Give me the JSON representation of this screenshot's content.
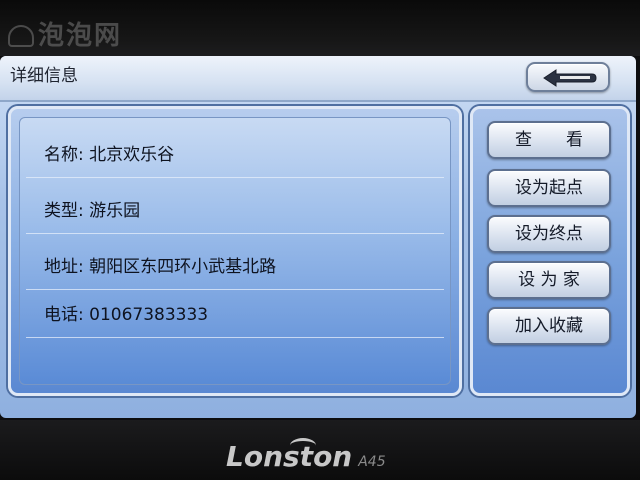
{
  "watermark": "泡泡网",
  "window": {
    "title": "详细信息"
  },
  "details": [
    {
      "text": "名称: 北京欢乐谷"
    },
    {
      "text": "类型: 游乐园"
    },
    {
      "text": "地址: 朝阳区东四环小武基北路"
    },
    {
      "text": "电话: 01067383333"
    }
  ],
  "actions": {
    "view": "查　　看",
    "set_start": "设为起点",
    "set_end": "设为终点",
    "set_home": "设 为 家",
    "add_favorite": "加入收藏"
  },
  "device": {
    "brand": "Lonston",
    "model": "A45"
  },
  "icons": {
    "back": "back-arrow-icon"
  },
  "colors": {
    "screen_blue": "#8fb0df",
    "panel_border": "#dfe8f6",
    "text": "#0e1320"
  }
}
